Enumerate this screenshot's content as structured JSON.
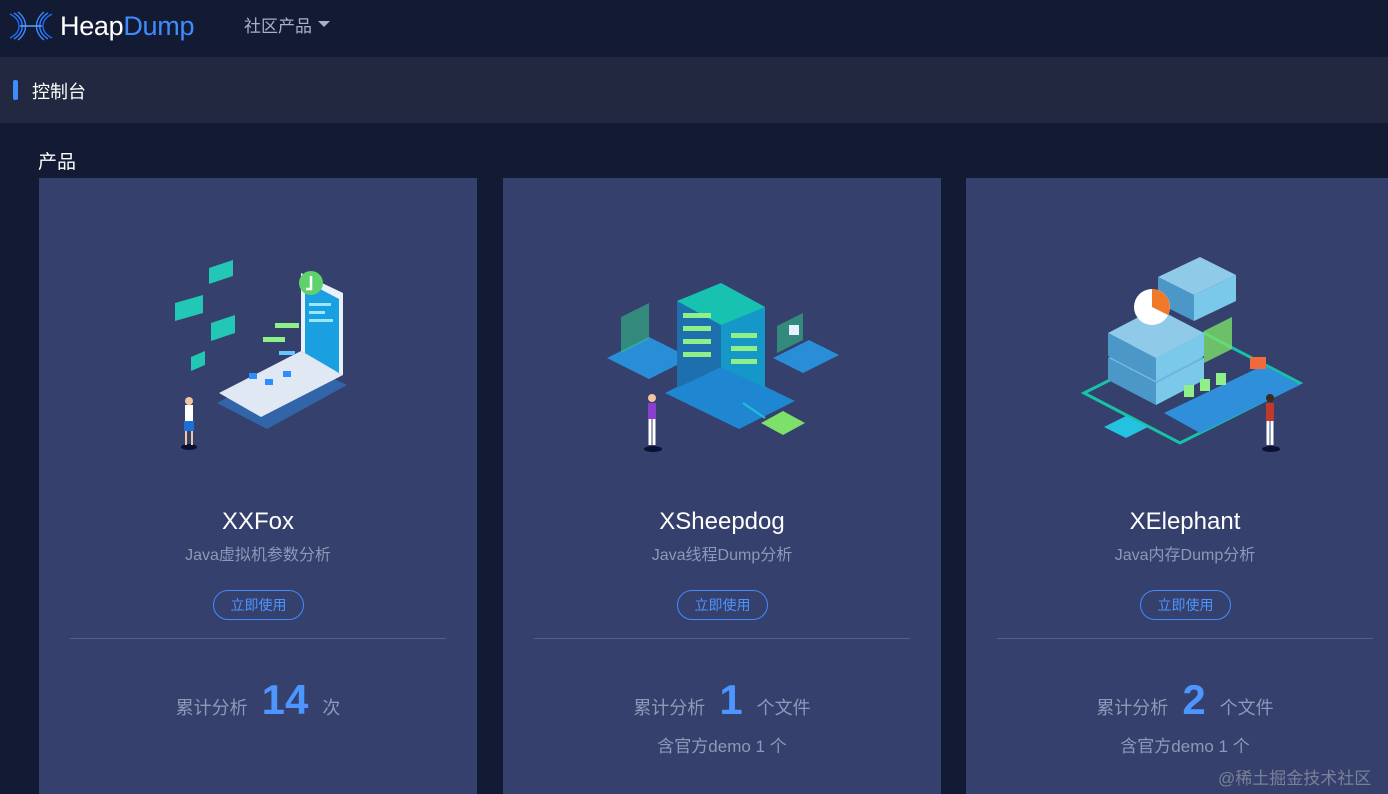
{
  "brand": {
    "name_main": "Heap",
    "name_accent": "Dump"
  },
  "nav": {
    "dropdown_label": "社区产品"
  },
  "page": {
    "title": "控制台",
    "section_title": "产品"
  },
  "cards": [
    {
      "name": "XXFox",
      "desc": "Java虚拟机参数分析",
      "button": "立即使用",
      "stat_label": "累计分析",
      "stat_value": "14",
      "stat_unit": "次",
      "note": ""
    },
    {
      "name": "XSheepdog",
      "desc": "Java线程Dump分析",
      "button": "立即使用",
      "stat_label": "累计分析",
      "stat_value": "1",
      "stat_unit": "个文件",
      "note": "含官方demo 1 个"
    },
    {
      "name": "XElephant",
      "desc": "Java内存Dump分析",
      "button": "立即使用",
      "stat_label": "累计分析",
      "stat_value": "2",
      "stat_unit": "个文件",
      "note": "含官方demo 1 个"
    }
  ],
  "watermark": "@稀土掘金技术社区",
  "colors": {
    "accent": "#3f8cff",
    "card_bg": "#35406c",
    "page_bg": "#131a33"
  }
}
